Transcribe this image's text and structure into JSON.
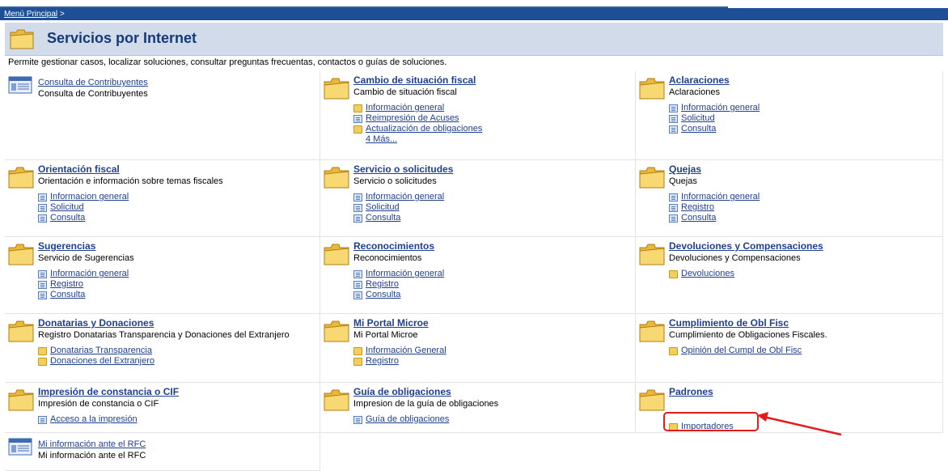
{
  "breadcrumb": {
    "home": "Menú Principal",
    "sep": ">"
  },
  "header": {
    "title": "Servicios por Internet"
  },
  "description": "Permite gestionar casos, localizar soluciones, consultar preguntas frecuentas, contactos o guías de soluciones.",
  "cells": [
    {
      "title": "Consulta de Contribuyentes",
      "subtitle": "Consulta de Contribuyentes",
      "icon": "table-icon",
      "links": []
    },
    {
      "title": "Cambio de situación fiscal",
      "subtitle": "Cambio de situación fiscal",
      "icon": "folder-icon",
      "links": [
        {
          "label": "Información general",
          "icon": "folder"
        },
        {
          "label": "Reimpresión de Acuses",
          "icon": "doc"
        },
        {
          "label": "Actualización de obligaciones",
          "icon": "folder"
        }
      ],
      "more": "4 Más..."
    },
    {
      "title": "Aclaraciones",
      "subtitle": "Aclaraciones",
      "icon": "folder-icon",
      "links": [
        {
          "label": "Información general",
          "icon": "doc"
        },
        {
          "label": "Solicitud",
          "icon": "doc"
        },
        {
          "label": "Consulta",
          "icon": "doc"
        }
      ]
    },
    {
      "title": "Orientación fiscal",
      "subtitle": "Orientación e información sobre temas fiscales",
      "icon": "folder-icon",
      "links": [
        {
          "label": "Informacion general",
          "icon": "doc"
        },
        {
          "label": "Solicitud",
          "icon": "doc"
        },
        {
          "label": "Consulta",
          "icon": "doc"
        }
      ]
    },
    {
      "title": "Servicio o solicitudes",
      "subtitle": "Servicio o solicitudes",
      "icon": "folder-icon",
      "links": [
        {
          "label": "Información general",
          "icon": "doc"
        },
        {
          "label": "Solicitud",
          "icon": "doc"
        },
        {
          "label": "Consulta",
          "icon": "doc"
        }
      ]
    },
    {
      "title": "Quejas",
      "subtitle": "Quejas",
      "icon": "folder-icon",
      "links": [
        {
          "label": "Información general",
          "icon": "doc"
        },
        {
          "label": "Registro",
          "icon": "doc"
        },
        {
          "label": "Consulta",
          "icon": "doc"
        }
      ]
    },
    {
      "title": "Sugerencias",
      "subtitle": "Servicio de Sugerencias",
      "icon": "folder-icon",
      "links": [
        {
          "label": "Información general",
          "icon": "doc"
        },
        {
          "label": "Registro",
          "icon": "doc"
        },
        {
          "label": "Consulta",
          "icon": "doc"
        }
      ]
    },
    {
      "title": "Reconocimientos",
      "subtitle": "Reconocimientos",
      "icon": "folder-icon",
      "links": [
        {
          "label": "Información general",
          "icon": "doc"
        },
        {
          "label": "Registro",
          "icon": "doc"
        },
        {
          "label": "Consulta",
          "icon": "doc"
        }
      ]
    },
    {
      "title": "Devoluciones y Compensaciones",
      "subtitle": "Devoluciones y Compensaciones",
      "icon": "folder-icon",
      "links": [
        {
          "label": "Devoluciones",
          "icon": "folder"
        }
      ]
    },
    {
      "title": "Donatarias y Donaciones",
      "subtitle": "Registro Donatarias Transparencia y Donaciones del Extranjero",
      "icon": "folder-icon",
      "links": [
        {
          "label": "Donatarias Transparencia",
          "icon": "folder"
        },
        {
          "label": "Donaciones del Extranjero",
          "icon": "folder"
        }
      ]
    },
    {
      "title": "Mi Portal Microe",
      "subtitle": "Mi Portal Microe",
      "icon": "folder-icon",
      "links": [
        {
          "label": "Información General",
          "icon": "folder"
        },
        {
          "label": "Registro",
          "icon": "folder"
        }
      ]
    },
    {
      "title": "Cumplimiento de Obl Fisc",
      "subtitle": "Cumplimiento de Obligaciones Fiscales.",
      "icon": "folder-icon",
      "links": [
        {
          "label": "Opinión del Cumpl de Obl Fisc",
          "icon": "folder"
        }
      ]
    },
    {
      "title": "Impresión de constancia o CIF",
      "subtitle": "Impresión de constancia o CIF",
      "icon": "folder-icon",
      "links": [
        {
          "label": "Acceso a la impresión",
          "icon": "doc"
        }
      ]
    },
    {
      "title": "Guía de obligaciones",
      "subtitle": "Impresion de la guía de obligaciones",
      "icon": "folder-icon",
      "links": [
        {
          "label": "Guía de obligaciones",
          "icon": "doc"
        }
      ]
    },
    {
      "title": "Padrones",
      "subtitle": "",
      "icon": "folder-icon",
      "links": [
        {
          "label": "Importadores",
          "icon": "folder"
        }
      ]
    },
    {
      "title": "Mi información ante el RFC",
      "subtitle": "Mi información ante el RFC",
      "icon": "table-icon",
      "links": []
    }
  ],
  "colors": {
    "brand_blue": "#1d4f96",
    "header_bg": "#d2dbe9",
    "link": "#1f3f8f",
    "highlight": "#e21b1b"
  }
}
